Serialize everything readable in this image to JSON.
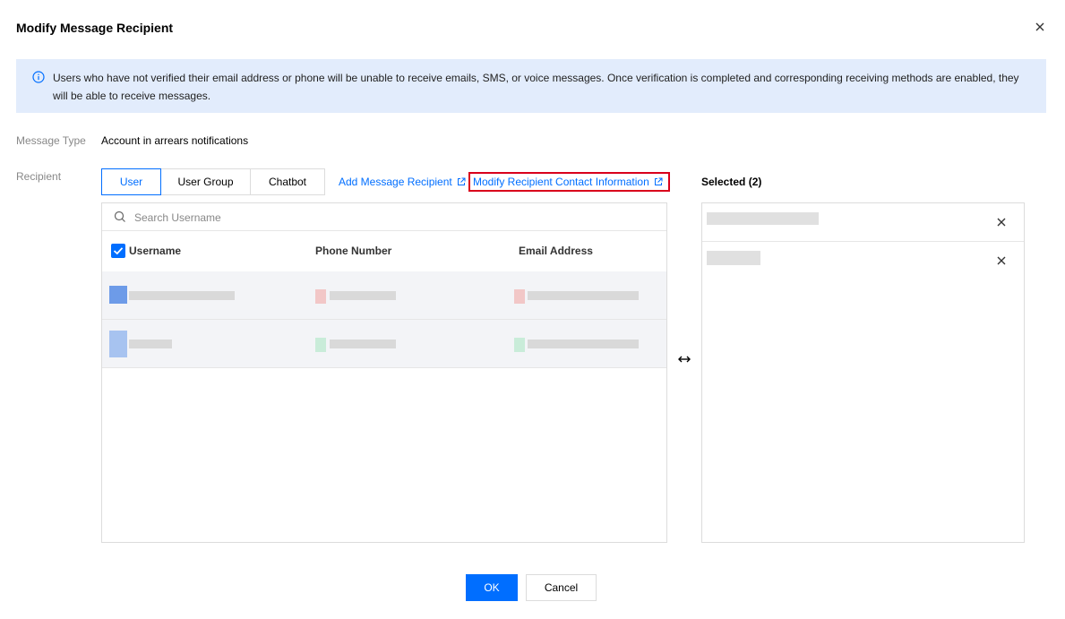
{
  "dialog": {
    "title": "Modify Message Recipient"
  },
  "notice": {
    "text": "Users who have not verified their email address or phone will be unable to receive emails, SMS, or voice messages. Once verification is completed and corresponding receiving methods are enabled, they will be able to receive messages.",
    "icon": "info-circle-icon"
  },
  "message_type": {
    "label": "Message Type",
    "value": "Account in arrears notifications"
  },
  "recipient": {
    "label": "Recipient",
    "tabs": [
      {
        "label": "User",
        "active": true
      },
      {
        "label": "User Group",
        "active": false
      },
      {
        "label": "Chatbot",
        "active": false
      }
    ],
    "add_link": "Add Message Recipient",
    "modify_link": "Modify Recipient Contact Information"
  },
  "search": {
    "placeholder": "Search Username"
  },
  "table": {
    "columns": [
      "Username",
      "Phone Number",
      "Email Address"
    ],
    "row_count": 2
  },
  "selected": {
    "title": "Selected (2)",
    "count": 2
  },
  "footer": {
    "ok_label": "OK",
    "cancel_label": "Cancel"
  },
  "colors": {
    "primary": "#006eff",
    "notice_bg": "#e2ecfc",
    "highlight": "#d9001b"
  }
}
